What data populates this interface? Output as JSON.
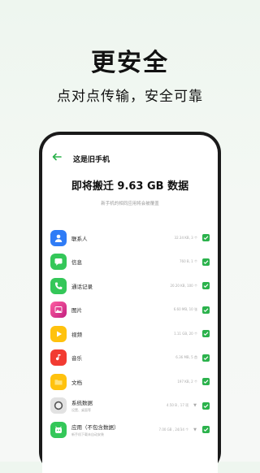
{
  "headline": "更安全",
  "subheadline": "点对点传输，安全可靠",
  "screen": {
    "nav_title": "这是旧手机",
    "back_icon": "arrow-left-icon",
    "big_title": "即将搬迁 9.63 GB 数据",
    "note": "新手机的相同应用将会被覆盖",
    "items": [
      {
        "name": "联系人",
        "size": "32.34 KB, 3 个",
        "icon": "contacts-icon",
        "color": "#2f7cf6",
        "checked": true
      },
      {
        "name": "信息",
        "size": "760 B, 1 个",
        "icon": "message-icon",
        "color": "#34c759",
        "checked": true
      },
      {
        "name": "通话记录",
        "size": "20.20 KB, 100 个",
        "icon": "phone-icon",
        "color": "#34c759",
        "checked": true
      },
      {
        "name": "图片",
        "size": "6.60 MB, 10 张",
        "icon": "gallery-icon",
        "color": "#e0358f",
        "checked": true
      },
      {
        "name": "视频",
        "size": "1.11 GB, 20 个",
        "icon": "video-icon",
        "color": "#ffc20e",
        "checked": true
      },
      {
        "name": "音乐",
        "size": "6.36 MB, 5 首",
        "icon": "music-icon",
        "color": "#f23b32",
        "checked": true
      },
      {
        "name": "文档",
        "size": "197 KB, 2 个",
        "icon": "folder-icon",
        "color": "#ffc20e",
        "checked": true
      },
      {
        "name": "系统数据",
        "sub": "设置、桌面等",
        "size": "4.50 B , 17 项",
        "icon": "settings-icon",
        "color": "#d9d9d9",
        "checked": true,
        "expandable": true
      },
      {
        "name": "应用（不包含数据）",
        "sub": "新手机下载未自动安装",
        "size": "7.00 GB , 24/34 个",
        "icon": "app-icon",
        "color": "#34c759",
        "checked": true,
        "expandable": true
      }
    ]
  }
}
